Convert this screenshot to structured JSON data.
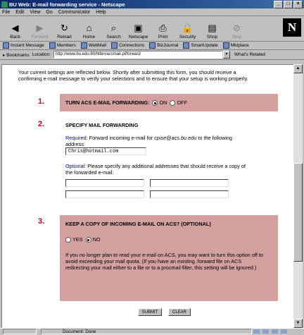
{
  "window": {
    "title": "BU Web: E-mail forwarding service - Netscape"
  },
  "menu": [
    "File",
    "Edit",
    "View",
    "Go",
    "Communicator",
    "Help"
  ],
  "toolbar": [
    {
      "label": "Back",
      "icon": "back-arrow-icon",
      "glyph": "◀",
      "enabled": true
    },
    {
      "label": "Forward",
      "icon": "forward-arrow-icon",
      "glyph": "▶",
      "enabled": false
    },
    {
      "label": "Reload",
      "icon": "reload-icon",
      "glyph": "↻",
      "enabled": true
    },
    {
      "label": "Home",
      "icon": "home-icon",
      "glyph": "⌂",
      "enabled": true
    },
    {
      "label": "Search",
      "icon": "search-icon",
      "glyph": "⌕",
      "enabled": true
    },
    {
      "label": "Netscape",
      "icon": "netscape-icon",
      "glyph": "▣",
      "enabled": true
    },
    {
      "label": "Print",
      "icon": "print-icon",
      "glyph": "⎙",
      "enabled": true
    },
    {
      "label": "Security",
      "icon": "lock-icon",
      "glyph": "🔒",
      "enabled": true
    },
    {
      "label": "Shop",
      "icon": "shop-icon",
      "glyph": "▤",
      "enabled": true
    },
    {
      "label": "Stop",
      "icon": "stop-icon",
      "glyph": "⊘",
      "enabled": false
    }
  ],
  "personal_toolbar": [
    "Instant Message",
    "Members",
    "WebMail",
    "Connections",
    "BizJournal",
    "SmartUpdate",
    "Mktplace"
  ],
  "location": {
    "bookmarks_label": "Bookmarks",
    "location_label": "Location:",
    "url": "http://www.bu.edu:80/htbin/acsmail.pl/forward",
    "related_label": "What's Related"
  },
  "content": {
    "intro": "Your current settings are reflected below. Shortly after submitting this form, you should receive a confirming e-mail message to verify your selections and to ensure that your setup is working properly.",
    "section1": {
      "number": "1.",
      "heading": "TURN ACS E-MAIL FORWARDING:",
      "on_label": "ON",
      "off_label": "OFF",
      "selected": "ON"
    },
    "section2": {
      "number": "2.",
      "heading": "SPECIFY MAIL FORWARDING",
      "required_label": "Required:",
      "required_text_a": " Forward incoming e-mail for ",
      "required_email": "cpise@acs.bu.edu",
      "required_text_b": " to the following address:",
      "forward_address": "Chris@hotmail.com",
      "optional_label": "Optional:",
      "optional_text": " Please specify any additional addresses that should receive a copy of the forwarded e-mail:",
      "extra_addresses": [
        "",
        "",
        "",
        ""
      ]
    },
    "section3": {
      "number": "3.",
      "heading": "KEEP A COPY OF INCOMING E-MAIL ON ACS? (OPTIONAL)",
      "yes_label": "YES",
      "no_label": "NO",
      "selected": "NO",
      "note": "If you no longer plan to read your e-mail on ACS, you may want to turn this option off to avoid exceeding your mail quota. (If you have an existing .forward file on ACS redirecting your mail either to a file or to a procmail filter, this setting will be ignored.)"
    },
    "buttons": {
      "submit": "SUBMIT",
      "clear": "CLEAR"
    }
  },
  "status": {
    "text": "Document: Done"
  },
  "colors": {
    "section_box": "#d4a0a0",
    "section_number": "#c4001f",
    "title_bar": "#0a246a"
  }
}
